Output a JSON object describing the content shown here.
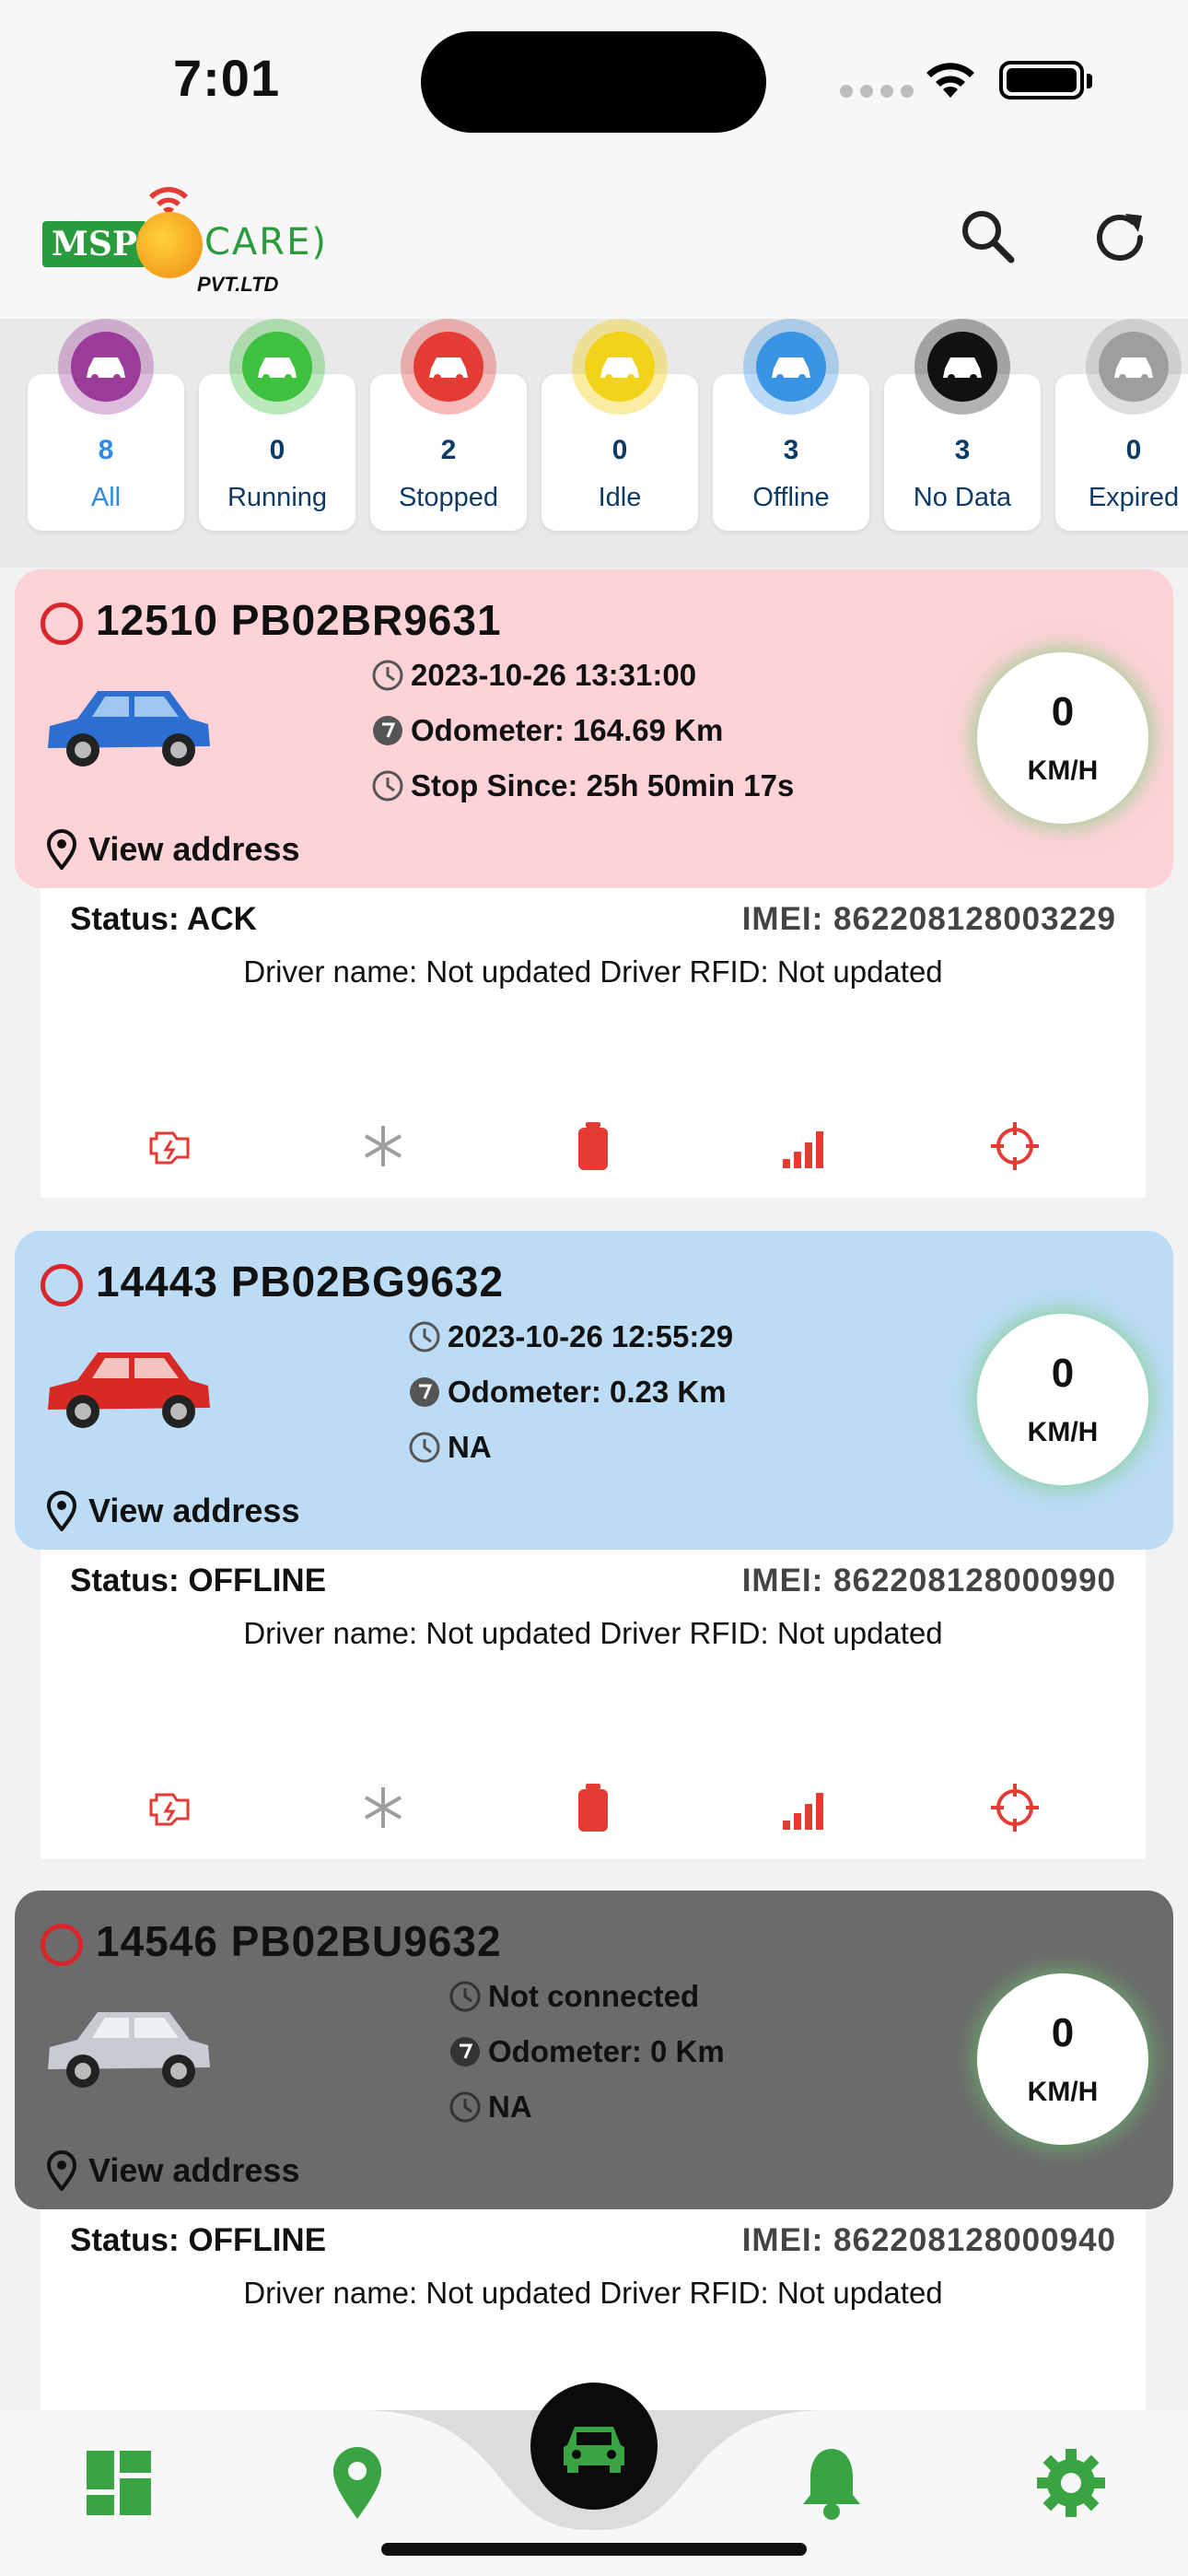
{
  "status_bar": {
    "time": "7:01"
  },
  "header": {
    "logo": {
      "left": "MSP",
      "right": "CARE",
      "sub": "PVT.LTD"
    },
    "icons": [
      "search-icon",
      "refresh-icon"
    ]
  },
  "filters": [
    {
      "count": "8",
      "label": "All",
      "color": "#9b3c9b",
      "active": true
    },
    {
      "count": "0",
      "label": "Running",
      "color": "#3ec13e"
    },
    {
      "count": "2",
      "label": "Stopped",
      "color": "#e53b35"
    },
    {
      "count": "0",
      "label": "Idle",
      "color": "#f3d21a"
    },
    {
      "count": "3",
      "label": "Offline",
      "color": "#3a94e6"
    },
    {
      "count": "3",
      "label": "No Data",
      "color": "#111111"
    },
    {
      "count": "0",
      "label": "Expired",
      "color": "#9e9e9e"
    }
  ],
  "vehicles": [
    {
      "title": "12510 PB02BR9631",
      "timestamp": "2023-10-26 13:31:00",
      "odometer": "Odometer: 164.69 Km",
      "since": "Stop Since: 25h 50min 17s",
      "speed": "0",
      "speed_unit": "KM/H",
      "view_address": "View address",
      "status": "Status: ACK",
      "imei": "IMEI: 862208128003229",
      "driver": "Driver name: Not updated Driver RFID: Not updated",
      "bg": "#fdd3d8",
      "car_color": "#2d6fd1"
    },
    {
      "title": "14443 PB02BG9632",
      "timestamp": "2023-10-26 12:55:29",
      "odometer": "Odometer: 0.23 Km",
      "since": "NA",
      "speed": "0",
      "speed_unit": "KM/H",
      "view_address": "View address",
      "status": "Status: OFFLINE",
      "imei": "IMEI: 862208128000990",
      "driver": "Driver name: Not updated Driver RFID: Not updated",
      "bg": "#bcdcf6",
      "car_color": "#d82a24"
    },
    {
      "title": "14546 PB02BU9632",
      "timestamp": "Not connected",
      "odometer": "Odometer: 0 Km",
      "since": "NA",
      "speed": "0",
      "speed_unit": "KM/H",
      "view_address": "View address",
      "status": "Status: OFFLINE",
      "imei": "IMEI: 862208128000940",
      "driver": "Driver name: Not updated Driver RFID: Not updated",
      "bg": "#6b6b6b",
      "car_color": "#c8ccd2"
    }
  ],
  "feature_icons": [
    "engine-icon",
    "ac-icon",
    "battery-icon",
    "signal-icon",
    "gps-icon"
  ],
  "bottom_nav": [
    "dashboard-icon",
    "location-icon",
    "vehicle-icon",
    "bell-icon",
    "settings-icon"
  ],
  "colors": {
    "accent_green": "#3aa344",
    "alert_red": "#e53b35"
  }
}
